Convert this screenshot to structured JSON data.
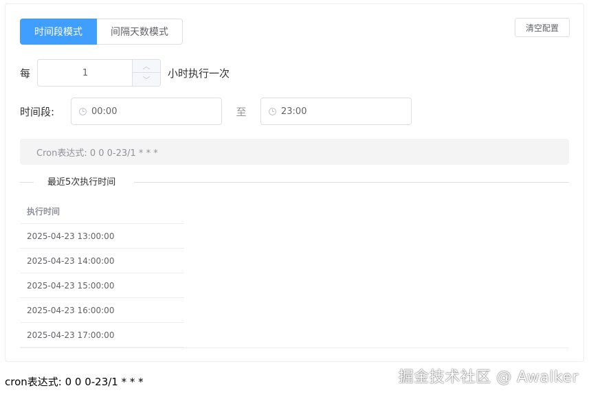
{
  "modes": {
    "time_range_label": "时间段模式",
    "interval_days_label": "间隔天数模式"
  },
  "clear_label": "清空配置",
  "every": {
    "prefix": "每",
    "value": "1",
    "suffix": "小时执行一次"
  },
  "range": {
    "label": "时间段:",
    "start": "00:00",
    "to": "至",
    "end": "23:00"
  },
  "cron_box_text": "Cron表达式: 0 0 0-23/1 * * *",
  "recent_title": "最近5次执行时间",
  "table": {
    "header": "执行时间",
    "rows": [
      "2025-04-23 13:00:00",
      "2025-04-23 14:00:00",
      "2025-04-23 15:00:00",
      "2025-04-23 16:00:00",
      "2025-04-23 17:00:00"
    ]
  },
  "footer_cron": "cron表达式: 0 0 0-23/1 * * *",
  "watermark": "掘金技术社区 @ Awalker",
  "colors": {
    "primary": "#409eff",
    "border": "#dcdfe6",
    "cron_bg": "#f4f4f5"
  }
}
